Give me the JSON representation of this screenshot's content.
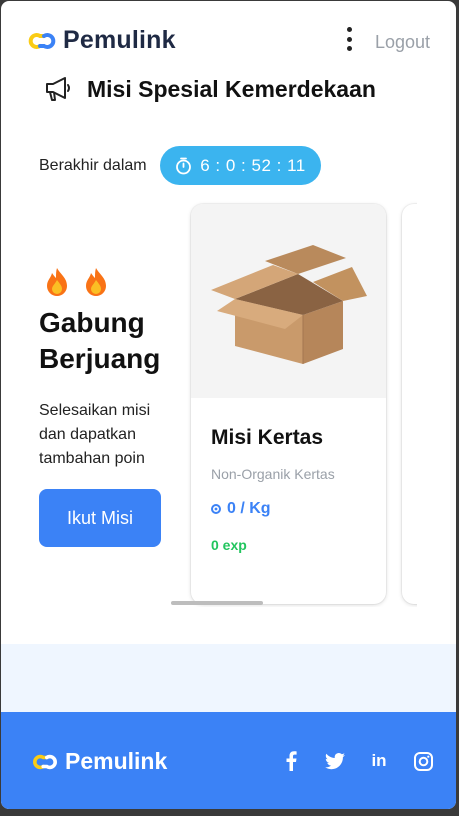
{
  "header": {
    "brand": "Pemulink",
    "logout_label": "Logout"
  },
  "mission": {
    "title": "Misi Spesial Kemerdekaan",
    "ends_label": "Berakhir dalam",
    "countdown": "6 : 0 : 52 : 11"
  },
  "promo": {
    "title": "Gabung Berjuang",
    "description": "Selesaikan misi dan dapatkan tambahan poin",
    "button_label": "Ikut Misi",
    "flame_count": 2
  },
  "cards": [
    {
      "name": "Misi Kertas",
      "category": "Non-Organik Kertas",
      "points": "0 / Kg",
      "exp": "0 exp"
    }
  ],
  "footer": {
    "brand": "Pemulink",
    "linkedin_label": "in"
  },
  "colors": {
    "primary": "#3b82f6",
    "timer": "#3bb4ef",
    "exp": "#22c55e",
    "band": "#eff6ff"
  },
  "icons": {
    "brand": "chain-link-icon",
    "menu": "kebab-menu-icon",
    "mission": "megaphone-icon",
    "timer": "stopwatch-icon",
    "promo": "flame-icon",
    "points": "coin-icon",
    "social": [
      "facebook-icon",
      "twitter-icon",
      "linkedin-icon",
      "instagram-icon"
    ]
  }
}
